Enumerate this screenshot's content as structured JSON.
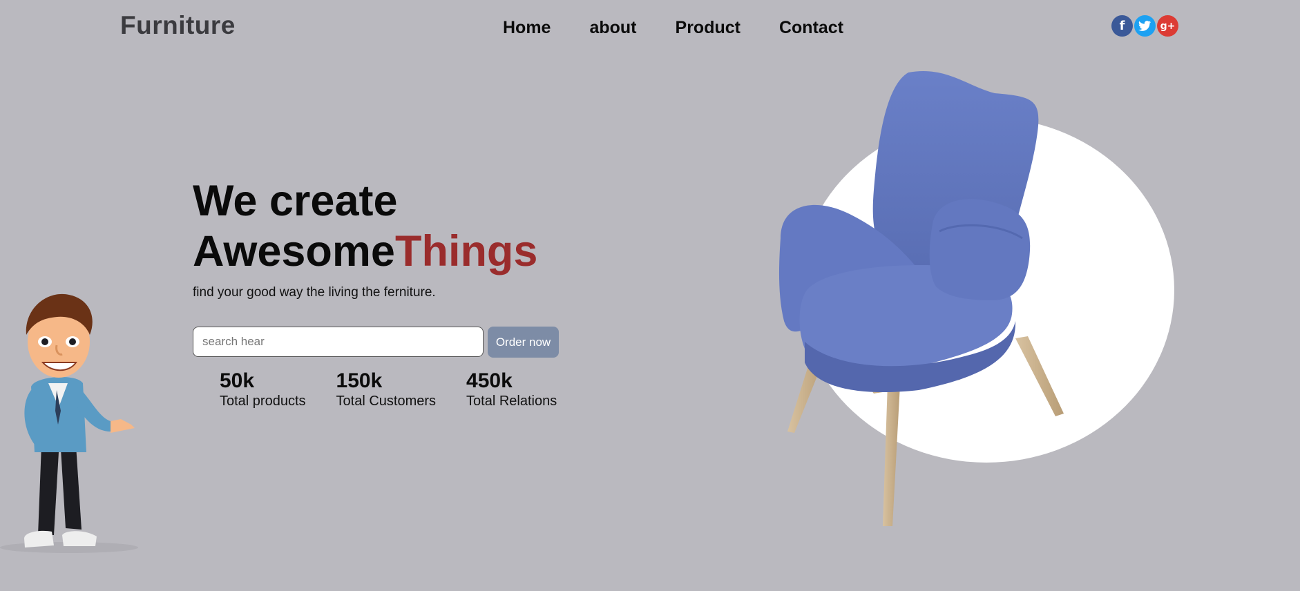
{
  "header": {
    "logo": "Furniture",
    "nav": [
      "Home",
      "about",
      "Product",
      "Contact"
    ],
    "social": [
      {
        "icon": "facebook-icon",
        "glyph": "f",
        "color": "#3b5998"
      },
      {
        "icon": "twitter-icon",
        "glyph": "t",
        "color": "#1da1f2"
      },
      {
        "icon": "google-plus-icon",
        "glyph": "g+",
        "color": "#dc3b34"
      }
    ]
  },
  "hero": {
    "line1": "We create",
    "line2_black": "Awesome",
    "line2_red": "Things",
    "tagline": "find your good way the living the ferniture.",
    "search_placeholder": "search hear",
    "order_label": "Order now",
    "stats": [
      {
        "value": "50k",
        "label": "Total products"
      },
      {
        "value": "150k",
        "label": "Total Customers"
      },
      {
        "value": "450k",
        "label": "Total Relations"
      }
    ]
  },
  "colors": {
    "background": "#bab9bf",
    "accent_red": "#9a2c2c",
    "button": "#7d8ca6",
    "chair_blue": "#5f76c0"
  }
}
